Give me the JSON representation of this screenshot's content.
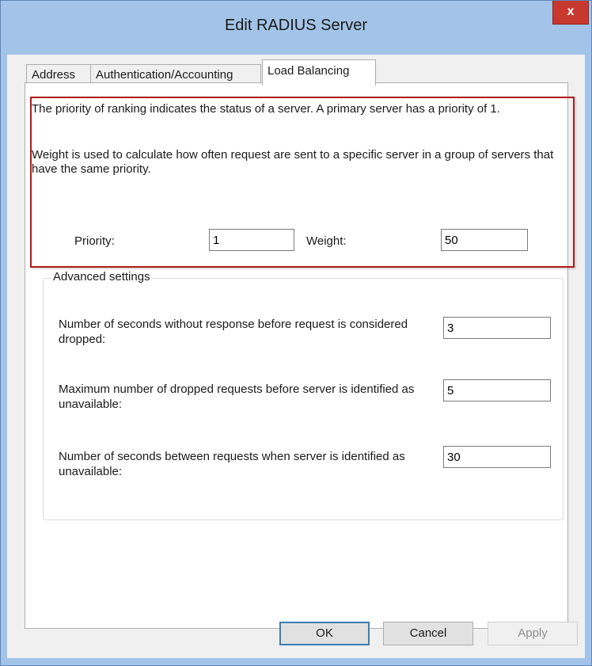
{
  "window": {
    "title": "Edit RADIUS Server",
    "close_label": "x"
  },
  "tabs": [
    {
      "label": "Address",
      "active": false
    },
    {
      "label": "Authentication/Accounting",
      "active": false
    },
    {
      "label": "Load Balancing",
      "active": true
    }
  ],
  "load_balancing": {
    "priority_description": "The priority of ranking indicates the status of a server. A primary server has a priority of 1.",
    "weight_description": "Weight is used to calculate how often request are sent to a specific server in a group of servers that have the same priority.",
    "priority_label": "Priority:",
    "priority_value": "1",
    "weight_label": "Weight:",
    "weight_value": "50"
  },
  "advanced": {
    "title": "Advanced settings",
    "timeout_label": "Number of seconds without response before request is considered dropped:",
    "timeout_value": "3",
    "max_dropped_label": "Maximum number of dropped requests before server is identified as unavailable:",
    "max_dropped_value": "5",
    "interval_label": "Number of seconds between requests when server is identified as unavailable:",
    "interval_value": "30"
  },
  "buttons": {
    "ok": "OK",
    "cancel": "Cancel",
    "apply": "Apply"
  },
  "colors": {
    "frame": "#a3c4e8",
    "close_button": "#c7392f",
    "highlight_box": "#b51b1b",
    "panel": "#ffffff"
  }
}
